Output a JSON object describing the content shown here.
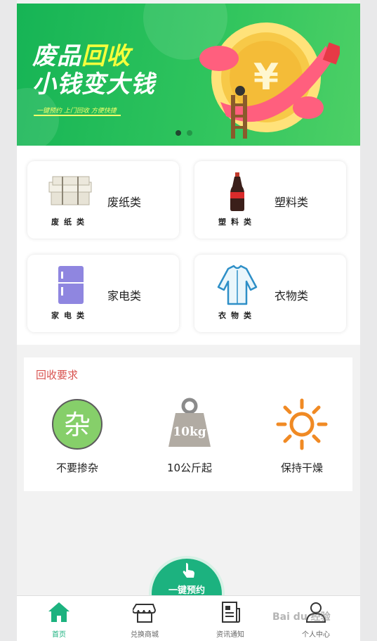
{
  "banner": {
    "title_line1_a": "废品",
    "title_line1_b": "回收",
    "title_line2": "小钱变大钱",
    "subtitle": "一键预约 上门回收 方便快捷",
    "coin_symbol": "¥",
    "carousel": {
      "current": 1,
      "total": 2
    }
  },
  "categories": [
    {
      "icon": "paper-bundle-icon",
      "small_label": "废纸类",
      "label": "废纸类"
    },
    {
      "icon": "cola-bottle-icon",
      "small_label": "塑料类",
      "label": "塑料类"
    },
    {
      "icon": "fridge-icon",
      "small_label": "家电类",
      "label": "家电类"
    },
    {
      "icon": "shirt-icon",
      "small_label": "衣物类",
      "label": "衣物类"
    }
  ],
  "requirements": {
    "title": "回收要求",
    "items": [
      {
        "icon": "mixed-badge-icon",
        "glyph": "杂",
        "label": "不要掺杂"
      },
      {
        "icon": "weight-icon",
        "glyph": "10kg",
        "label": "10公斤起"
      },
      {
        "icon": "sun-icon",
        "label": "保持干燥"
      }
    ]
  },
  "reserve_button": {
    "label": "一键预约"
  },
  "tabbar": {
    "items": [
      {
        "icon": "home-icon",
        "label": "首页",
        "active": true
      },
      {
        "icon": "store-icon",
        "label": "兑换商城",
        "active": false
      },
      {
        "icon": "news-icon",
        "label": "资讯通知",
        "active": false
      },
      {
        "icon": "user-icon",
        "label": "个人中心",
        "active": false
      }
    ]
  },
  "watermark": "Bai du 经验",
  "colors": {
    "brand_green": "#1cb27f",
    "banner_green": "#2fc45d",
    "accent_red": "#d9534f",
    "sun_orange": "#f08a24"
  }
}
